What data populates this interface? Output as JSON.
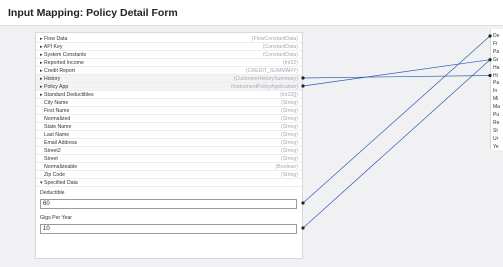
{
  "header": {
    "title": "Input Mapping: Policy Detail Form"
  },
  "source_fields": [
    {
      "label": "Flow Data",
      "type": "(FlowConstantData)",
      "expandable": true,
      "expanded": false
    },
    {
      "label": "API Key",
      "type": "(ConstantData)",
      "expandable": true,
      "expanded": false
    },
    {
      "label": "System Constants",
      "type": "(ConstantData)",
      "expandable": true,
      "expanded": false
    },
    {
      "label": "Reported Income",
      "type": "(Int32)",
      "expandable": true,
      "expanded": false
    },
    {
      "label": "Credit Report",
      "type": "(CREDIT_SUMMARY)",
      "expandable": true,
      "expanded": false
    },
    {
      "label": "History",
      "type": "(CustomerHistorySummary)",
      "expandable": true,
      "expanded": false,
      "linked": true
    },
    {
      "label": "Policy App",
      "type": "(InstrumentPolicyApplication)",
      "expandable": true,
      "expanded": false,
      "linked": true
    },
    {
      "label": "Standard Deductibles",
      "type": "(Int32[])",
      "expandable": true,
      "expanded": false
    },
    {
      "label": "City Name",
      "type": "(String)",
      "expandable": false
    },
    {
      "label": "First Name",
      "type": "(String)",
      "expandable": false
    },
    {
      "label": "Normalized",
      "type": "(String)",
      "expandable": false
    },
    {
      "label": "State Name",
      "type": "(String)",
      "expandable": false
    },
    {
      "label": "Last Name",
      "type": "(String)",
      "expandable": false
    },
    {
      "label": "Email Address",
      "type": "(String)",
      "expandable": false
    },
    {
      "label": "Street2",
      "type": "(String)",
      "expandable": false
    },
    {
      "label": "Street",
      "type": "(String)",
      "expandable": false
    },
    {
      "label": "Normalizeable",
      "type": "(Boolean)",
      "expandable": false
    },
    {
      "label": "Zip Code",
      "type": "(String)",
      "expandable": false
    },
    {
      "label": "Specified Data",
      "type": "",
      "expandable": true,
      "expanded": true
    }
  ],
  "specified_data": [
    {
      "label": "Deductible",
      "value": "60"
    },
    {
      "label": "Gigs Per Year",
      "value": "10"
    }
  ],
  "target_fields": [
    {
      "label": "De",
      "linked": true
    },
    {
      "label": "Fr",
      "linked": false
    },
    {
      "label": "Pa",
      "linked": false
    },
    {
      "label": "Gr",
      "linked": true
    },
    {
      "label": "Ha",
      "linked": false
    },
    {
      "label": "Hi",
      "linked": true
    },
    {
      "label": "Pa",
      "linked": false
    },
    {
      "label": "In",
      "linked": false
    },
    {
      "label": "Mi",
      "linked": false
    },
    {
      "label": "Ma",
      "linked": false
    },
    {
      "label": "Pu",
      "linked": false
    },
    {
      "label": "Re",
      "linked": false
    },
    {
      "label": "St",
      "linked": false
    },
    {
      "label": "Ur",
      "linked": false
    },
    {
      "label": "Ye",
      "linked": false
    }
  ],
  "colors": {
    "accent": "#2b5fb0",
    "background": "#4a2a6e"
  },
  "icons": {
    "collapsed": "triangle-right-icon",
    "expanded": "triangle-down-icon",
    "connector": "dot-icon"
  }
}
